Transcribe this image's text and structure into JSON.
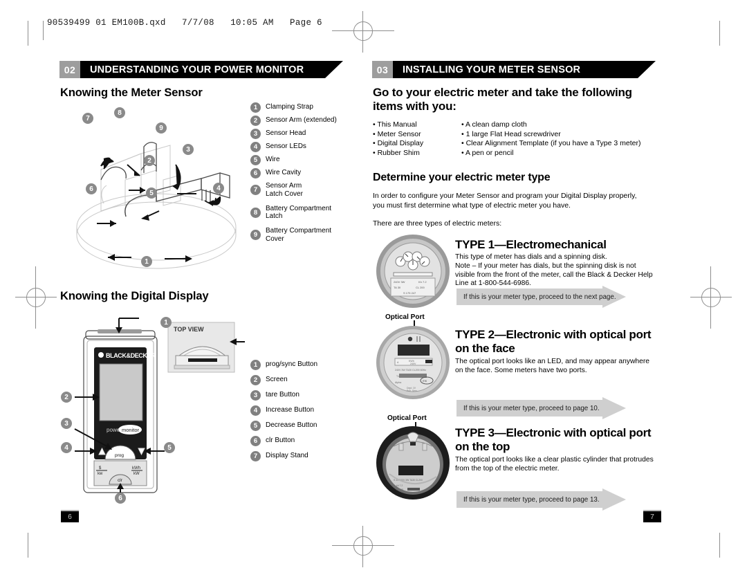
{
  "print_slug": "90539499 01 EM100B.qxd   7/7/08   10:05 AM   Page 6",
  "colors": {
    "banner_black": "#000000",
    "banner_number_gray": "#9d9d9d",
    "callout_gray": "#808080",
    "arrow_gray": "#cfcfcf",
    "regmark_gray": "#8d8d8d"
  },
  "left_page": {
    "banner": {
      "number": "02",
      "title": "UNDERSTANDING YOUR POWER MONITOR"
    },
    "heading_sensor": "Knowing the Meter Sensor",
    "heading_display": "Knowing the Digital Display",
    "page_number": "6",
    "sensor_legend": [
      {
        "num": "1",
        "label": "Clamping Strap"
      },
      {
        "num": "2",
        "label": "Sensor Arm (extended)"
      },
      {
        "num": "3",
        "label": "Sensor Head"
      },
      {
        "num": "4",
        "label": "Sensor LEDs"
      },
      {
        "num": "5",
        "label": "Wire"
      },
      {
        "num": "6",
        "label": "Wire Cavity"
      },
      {
        "num": "7",
        "label": "Sensor Arm\nLatch Cover"
      },
      {
        "num": "8",
        "label": "Battery Compartment\nLatch"
      },
      {
        "num": "9",
        "label": "Battery Compartment\nCover"
      }
    ],
    "display_legend": [
      {
        "num": "1",
        "label": "prog/sync Button"
      },
      {
        "num": "2",
        "label": "Screen"
      },
      {
        "num": "3",
        "label": "tare Button"
      },
      {
        "num": "4",
        "label": "Increase Button"
      },
      {
        "num": "5",
        "label": "Decrease Button"
      },
      {
        "num": "6",
        "label": "clr Button"
      },
      {
        "num": "7",
        "label": "Display Stand"
      }
    ],
    "illustration_sensor": {
      "callouts": [
        "1",
        "2",
        "3",
        "4",
        "5",
        "6",
        "7",
        "8",
        "9"
      ]
    },
    "illustration_display": {
      "brand": "BLACK&DECKER",
      "inset_label": "TOP VIEW",
      "callouts": [
        "1",
        "2",
        "3",
        "4",
        "5",
        "6"
      ],
      "button_labels": [
        "$\nkw",
        "kWh\nkW",
        "clr"
      ]
    }
  },
  "right_page": {
    "banner": {
      "number": "03",
      "title": "INSTALLING YOUR METER SENSOR"
    },
    "heading_goto": "Go to your electric meter and take the following items with you:",
    "items_column_1": [
      "This Manual",
      "Meter Sensor",
      "Digital Display",
      "Rubber Shim"
    ],
    "items_column_2": [
      "A clean damp cloth",
      "1 large Flat Head screwdriver",
      "Clear Alignment Template (if you have a Type 3 meter)",
      "A pen or pencil"
    ],
    "heading_determine": "Determine your electric meter type",
    "paragraph_determine": "In order to configure your Meter Sensor and program your Digital Display properly, you must first determine what type of electric meter you have.",
    "paragraph_three_types": "There are three types of electric meters:",
    "optical_port_label": "Optical Port",
    "page_number": "7",
    "types": [
      {
        "title": "TYPE 1—Electromechanical",
        "body": "This type of meter has dials and a spinning disk.\nNote – If your meter has dials, but the spinning disk is not visible from the front of the meter, call the Black & Decker Help Line at 1-800-544-6986.",
        "arrow_text": "If this is your meter type, proceed to the next page."
      },
      {
        "title": "TYPE 2—Electronic with optical port on the face",
        "body": "The optical port looks like an LED, and may appear anywhere on the face.  Some meters have two ports.",
        "arrow_text": "If this is your meter type, proceed to page 10."
      },
      {
        "title": "TYPE 3—Electronic with optical port on the top",
        "body": "The optical port looks like a clear plastic cylinder that protrudes from the top of the electric meter.",
        "arrow_text": "If this is your meter type, proceed to page 13."
      }
    ]
  }
}
